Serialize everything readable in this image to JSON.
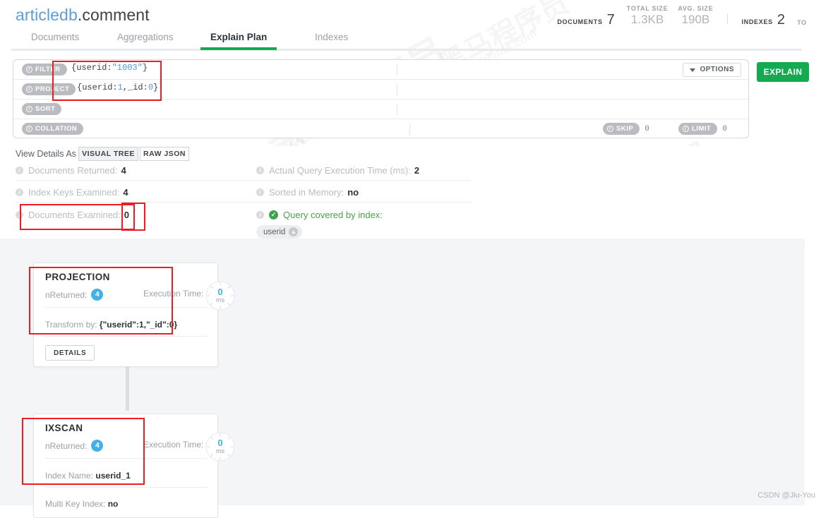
{
  "header": {
    "database": "articledb",
    "separator": ".",
    "collection": "comment",
    "stats": [
      {
        "label": "DOCUMENTS",
        "value": "7",
        "inline": true
      },
      {
        "label": "TOTAL SIZE",
        "value": "1.3KB",
        "inline": false
      },
      {
        "label": "AVG. SIZE",
        "value": "190B",
        "inline": false
      },
      {
        "label": "INDEXES",
        "value": "2",
        "inline": true
      },
      {
        "label": "TO",
        "value": "",
        "inline": false
      }
    ]
  },
  "tabs": [
    {
      "label": "Documents",
      "active": false
    },
    {
      "label": "Aggregations",
      "active": false
    },
    {
      "label": "Explain Plan",
      "active": true
    },
    {
      "label": "Indexes",
      "active": false
    }
  ],
  "query_bar": {
    "rows": [
      {
        "pill": "FILTER",
        "value_html": "{userid:<span class=\"str\">\"1003\"</span>}"
      },
      {
        "pill": "PROJECT",
        "value_html": "{userid:<span class=\"num\">1</span>,_id:<span class=\"num\">0</span>}"
      },
      {
        "pill": "SORT",
        "value_html": ""
      },
      {
        "pill": "COLLATION",
        "value_html": ""
      }
    ],
    "skip": {
      "label": "SKIP",
      "value": "0"
    },
    "limit": {
      "label": "LIMIT",
      "value": "0"
    },
    "options_label": "OPTIONS",
    "explain_label": "EXPLAIN"
  },
  "view_details": {
    "label": "View Details As",
    "options": [
      {
        "label": "VISUAL TREE",
        "active": true
      },
      {
        "label": "RAW JSON",
        "active": false
      }
    ]
  },
  "summary": {
    "left": [
      {
        "label": "Documents Returned:",
        "value": "4"
      },
      {
        "label": "Index Keys Examined:",
        "value": "4"
      },
      {
        "label": "Documents Examined:",
        "value": "0"
      }
    ],
    "right": [
      {
        "label": "Actual Query Execution Time (ms):",
        "value": "2"
      },
      {
        "label": "Sorted in Memory:",
        "value": "no"
      }
    ],
    "covered": {
      "text": "Query covered by index:",
      "index_chip": "userid"
    }
  },
  "tree": {
    "nodes": [
      {
        "title": "PROJECTION",
        "nreturned_label": "nReturned:",
        "nreturned_value": "4",
        "exec_label": "Execution Time:",
        "exec_value": "0",
        "exec_unit": "ms",
        "field_label": "Transform by:",
        "field_value": "{\"userid\":1,\"_id\":0}",
        "details_label": "DETAILS"
      },
      {
        "title": "IXSCAN",
        "nreturned_label": "nReturned:",
        "nreturned_value": "4",
        "exec_label": "Execution Time:",
        "exec_value": "0",
        "exec_unit": "ms",
        "field_label": "Index Name:",
        "field_value": "userid_1",
        "field2_label": "Multi Key Index:",
        "field2_value": "no"
      }
    ]
  },
  "watermarks": {
    "cn": "黑马程序员",
    "url": "www.itheima.com"
  },
  "credit": "CSDN @Jiu-You",
  "colors": {
    "accent_green": "#13aa52",
    "annotation_red": "#ee1c25",
    "badge_blue": "#43b1e8",
    "db_blue": "#5b9fd6"
  }
}
